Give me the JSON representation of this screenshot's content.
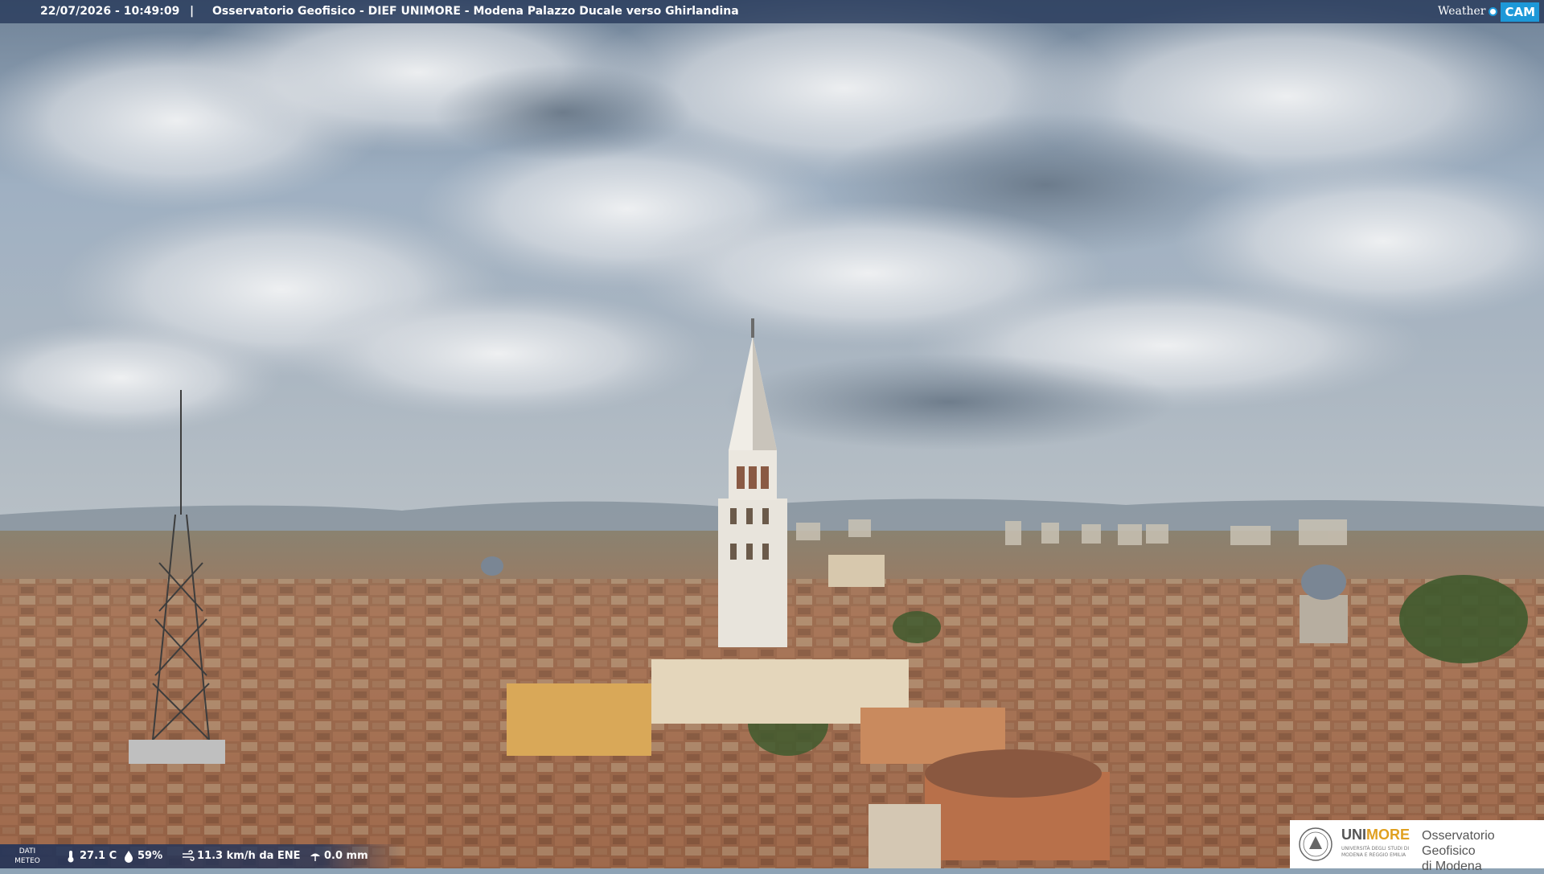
{
  "header": {
    "timestamp": "22/07/2026 - 10:49:09",
    "separator": "|",
    "title": "Osservatorio Geofisico - DIEF UNIMORE - Modena Palazzo Ducale verso Ghirlandina"
  },
  "brand": {
    "weather_text": "Weather",
    "cam_text": "CAM",
    "accent": "#1d98d8"
  },
  "weather": {
    "label_line1": "DATI",
    "label_line2": "METEO",
    "temperature": "27.1 C",
    "humidity": "59%",
    "wind": "11.3 km/h da ENE",
    "rain": "0.0 mm",
    "icons": [
      "thermometer-icon",
      "humidity-icon",
      "wind-icon",
      "rain-icon"
    ]
  },
  "logo": {
    "uni": "UNI",
    "more": "MORE",
    "uni_sub": "UNIVERSITÀ DEGLI STUDI DI MODENA E REGGIO EMILIA",
    "osserv_line1": "Osservatorio Geofisico",
    "osserv_line2": "di Modena"
  }
}
